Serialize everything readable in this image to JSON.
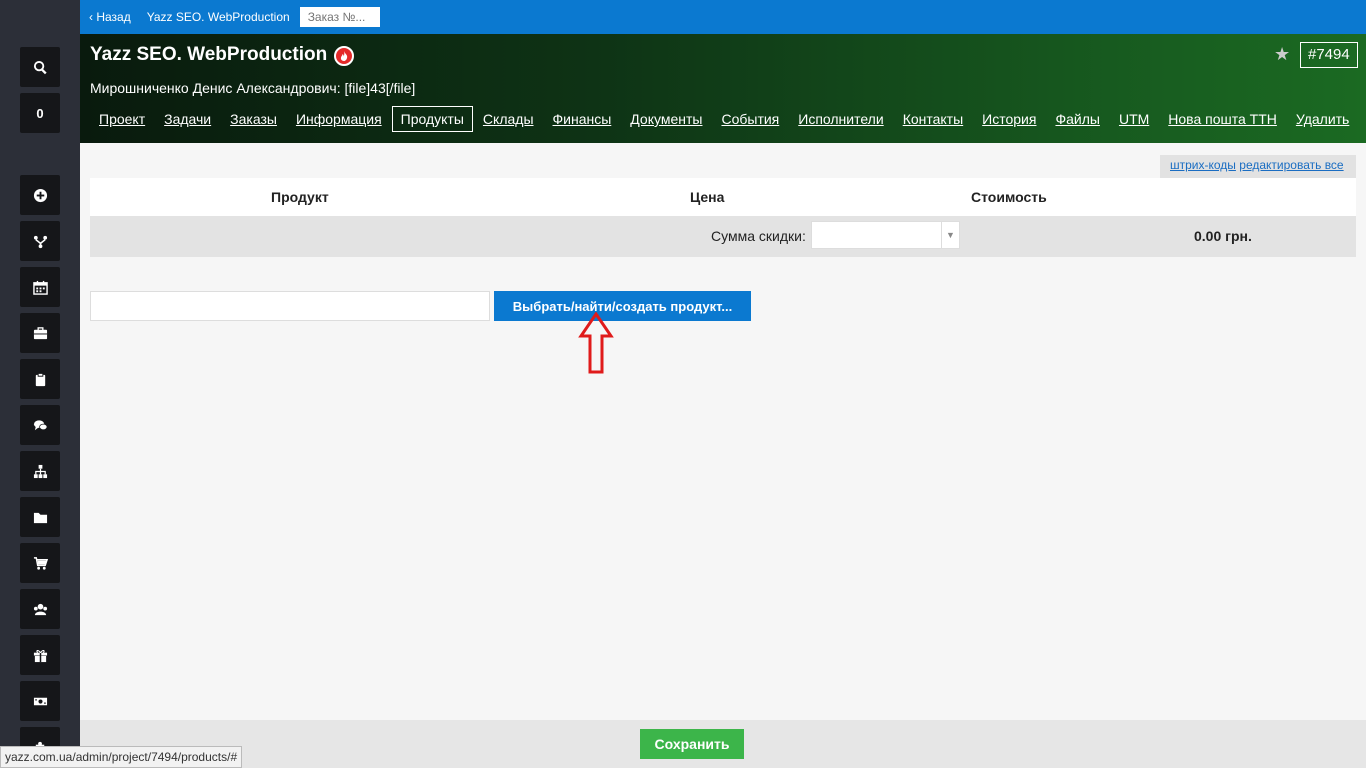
{
  "topbar": {
    "back_label": "‹ Назад",
    "crumb": "Yazz SEO. WebProduction",
    "order_placeholder": "Заказ №..."
  },
  "header": {
    "title": "Yazz SEO. WebProduction",
    "order_number": "#7494",
    "subtitle": "Мирошниченко Денис Александрович: [file]43[/file]",
    "tabs": [
      {
        "label": "Проект"
      },
      {
        "label": "Задачи"
      },
      {
        "label": "Заказы"
      },
      {
        "label": "Информация"
      },
      {
        "label": "Продукты"
      },
      {
        "label": "Склады"
      },
      {
        "label": "Финансы"
      },
      {
        "label": "Документы"
      },
      {
        "label": "События"
      },
      {
        "label": "Исполнители"
      },
      {
        "label": "Контакты"
      },
      {
        "label": "История"
      },
      {
        "label": "Файлы"
      },
      {
        "label": "UTM"
      },
      {
        "label": "Нова пошта ТТН"
      },
      {
        "label": "Удалить"
      }
    ],
    "active_tab": "Продукты"
  },
  "sidebar": {
    "counter": "0",
    "icons": [
      "search-icon",
      "plus-circle-icon",
      "fork-icon",
      "calendar-icon",
      "briefcase-icon",
      "clipboard-icon",
      "chat-icon",
      "sitemap-icon",
      "folder-icon",
      "cart-icon",
      "users-icon",
      "gift-icon",
      "money-icon",
      "puzzle-icon"
    ]
  },
  "products": {
    "links": {
      "barcodes": "штрих-коды",
      "edit_all": "редактировать все"
    },
    "columns": {
      "product": "Продукт",
      "price": "Цена",
      "cost": "Стоимость"
    },
    "discount_label": "Сумма скидки:",
    "discount_value": "",
    "total": "0.00 грн.",
    "select_button": "Выбрать/найти/создать продукт..."
  },
  "footer": {
    "save_label": "Сохранить"
  },
  "status_url": "yazz.com.ua/admin/project/7494/products/#",
  "colors": {
    "topbar": "#0b79d0",
    "sidebar": "#2c2f38",
    "save": "#3cb54a",
    "annotation_arrow": "#e01b1b"
  }
}
